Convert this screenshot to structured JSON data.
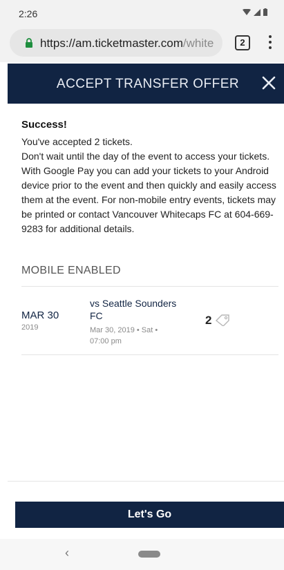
{
  "status_bar": {
    "time": "2:26"
  },
  "browser": {
    "url_host": "https://am.ticketmaster.com",
    "url_rest": "/white",
    "tab_count": "2"
  },
  "header": {
    "title": "ACCEPT TRANSFER OFFER",
    "close_icon": "close-icon"
  },
  "message": {
    "title": "Success!",
    "line1": "You've accepted 2 tickets.",
    "body": "Don't wait until the day of the event to access your tickets. With Google Pay you can add your tickets to your Android device prior to the event and then quickly and easily access them at the event. For non-mobile entry events, tickets may be printed or contact Vancouver Whitecaps FC at 604-669-9283 for additional details."
  },
  "section": {
    "label": "MOBILE ENABLED"
  },
  "event": {
    "date": "MAR 30",
    "year": "2019",
    "name": "vs Seattle Sounders FC",
    "meta": "Mar 30, 2019 • Sat • 07:00 pm",
    "ticket_count": "2",
    "ticket_icon": "ticket-icon"
  },
  "footer": {
    "cta_label": "Let's Go"
  },
  "nav": {
    "back_glyph": "‹"
  },
  "colors": {
    "brand_navy": "#112443"
  }
}
